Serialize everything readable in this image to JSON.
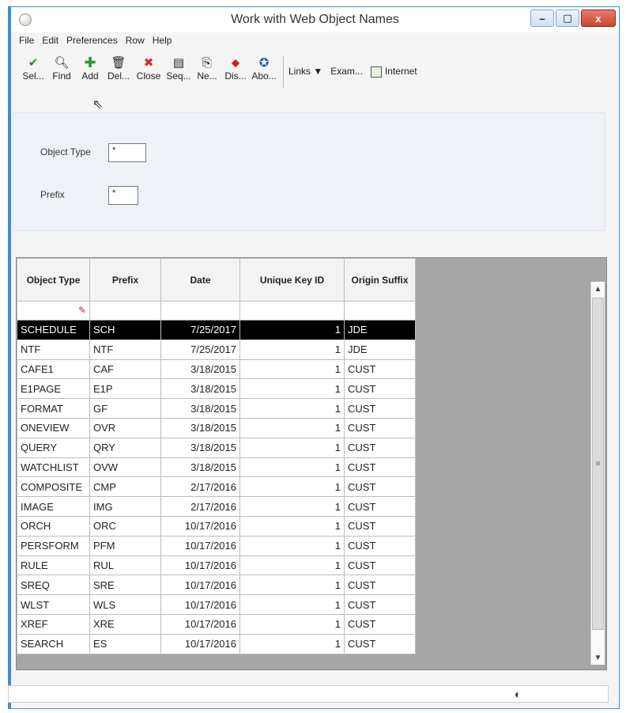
{
  "window": {
    "title": "Work with Web Object Names",
    "controls": {
      "minimize": "–",
      "maximize": "▢",
      "close": "x"
    }
  },
  "menu": [
    "File",
    "Edit",
    "Preferences",
    "Row",
    "Help"
  ],
  "toolbar": {
    "buttons": [
      {
        "label": "Sel...",
        "icon": "check-icon"
      },
      {
        "label": "Find",
        "icon": "find-icon"
      },
      {
        "label": "Add",
        "icon": "add-icon"
      },
      {
        "label": "Del...",
        "icon": "delete-icon"
      },
      {
        "label": "Close",
        "icon": "close-icon"
      },
      {
        "label": "Seq...",
        "icon": "sequence-icon"
      },
      {
        "label": "Ne...",
        "icon": "new-icon"
      },
      {
        "label": "Dis...",
        "icon": "display-icon"
      },
      {
        "label": "Abo...",
        "icon": "about-icon"
      }
    ],
    "links_label": "Links",
    "exam_label": "Exam...",
    "internet_label": "Internet"
  },
  "filters": {
    "object_type": {
      "label": "Object Type",
      "value": "*"
    },
    "prefix": {
      "label": "Prefix",
      "value": "*"
    }
  },
  "grid": {
    "columns": [
      "Object Type",
      "Prefix",
      "Date",
      "Unique Key ID",
      "Origin Suffix"
    ],
    "rows": [
      [
        "SCHEDULE",
        "SCH",
        "7/25/2017",
        "1",
        "JDE"
      ],
      [
        "NTF",
        "NTF",
        "7/25/2017",
        "1",
        "JDE"
      ],
      [
        "CAFE1",
        "CAF",
        "3/18/2015",
        "1",
        "CUST"
      ],
      [
        "E1PAGE",
        "E1P",
        "3/18/2015",
        "1",
        "CUST"
      ],
      [
        "FORMAT",
        "GF",
        "3/18/2015",
        "1",
        "CUST"
      ],
      [
        "ONEVIEW",
        "OVR",
        "3/18/2015",
        "1",
        "CUST"
      ],
      [
        "QUERY",
        "QRY",
        "3/18/2015",
        "1",
        "CUST"
      ],
      [
        "WATCHLIST",
        "OVW",
        "3/18/2015",
        "1",
        "CUST"
      ],
      [
        "COMPOSITE",
        "CMP",
        "2/17/2016",
        "1",
        "CUST"
      ],
      [
        "IMAGE",
        "IMG",
        "2/17/2016",
        "1",
        "CUST"
      ],
      [
        "ORCH",
        "ORC",
        "10/17/2016",
        "1",
        "CUST"
      ],
      [
        "PERSFORM",
        "PFM",
        "10/17/2016",
        "1",
        "CUST"
      ],
      [
        "RULE",
        "RUL",
        "10/17/2016",
        "1",
        "CUST"
      ],
      [
        "SREQ",
        "SRE",
        "10/17/2016",
        "1",
        "CUST"
      ],
      [
        "WLST",
        "WLS",
        "10/17/2016",
        "1",
        "CUST"
      ],
      [
        "XREF",
        "XRE",
        "10/17/2016",
        "1",
        "CUST"
      ],
      [
        "SEARCH",
        "ES",
        "10/17/2016",
        "1",
        "CUST"
      ]
    ],
    "selected_row": 0
  },
  "colors": {
    "accent": "#3a8fd0",
    "selected_bg": "#000000",
    "grid_empty": "#a6a6a6"
  }
}
